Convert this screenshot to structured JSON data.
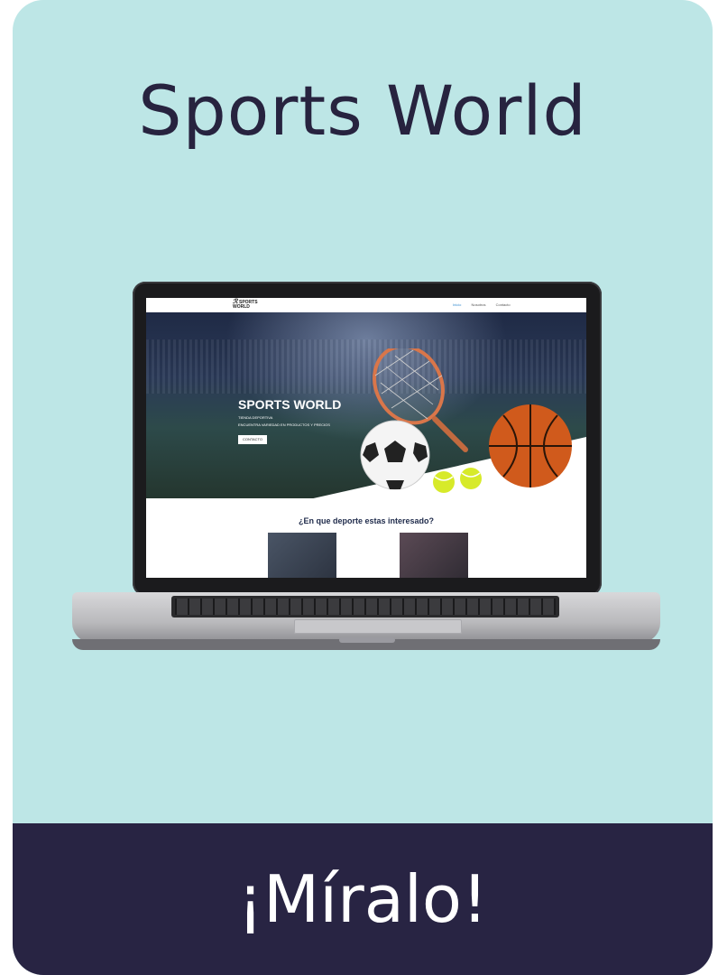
{
  "card": {
    "title": "Sports World",
    "cta": "¡Míralo!"
  },
  "colors": {
    "card_bg": "#bde6e6",
    "footer_bg": "#282443",
    "title_color": "#27233f"
  },
  "website": {
    "logo_line1": "SPORTS",
    "logo_line2": "WORLD",
    "nav": [
      "Inicio",
      "Nosotros",
      "Contacto"
    ],
    "hero_title": "SPORTS WORLD",
    "hero_sub1": "TIENDA DEPORTIVA",
    "hero_sub2": "ENCUENTRA VARIEDAD EN PRODUCTOS Y PRECIOS",
    "hero_button": "CONTACTO",
    "section_title": "¿En que deporte estas interesado?"
  },
  "icons": [
    "laptop",
    "soccer-ball-icon",
    "tennis-racket-icon",
    "tennis-ball-icon",
    "basketball-icon",
    "boxing-gloves-icon"
  ]
}
